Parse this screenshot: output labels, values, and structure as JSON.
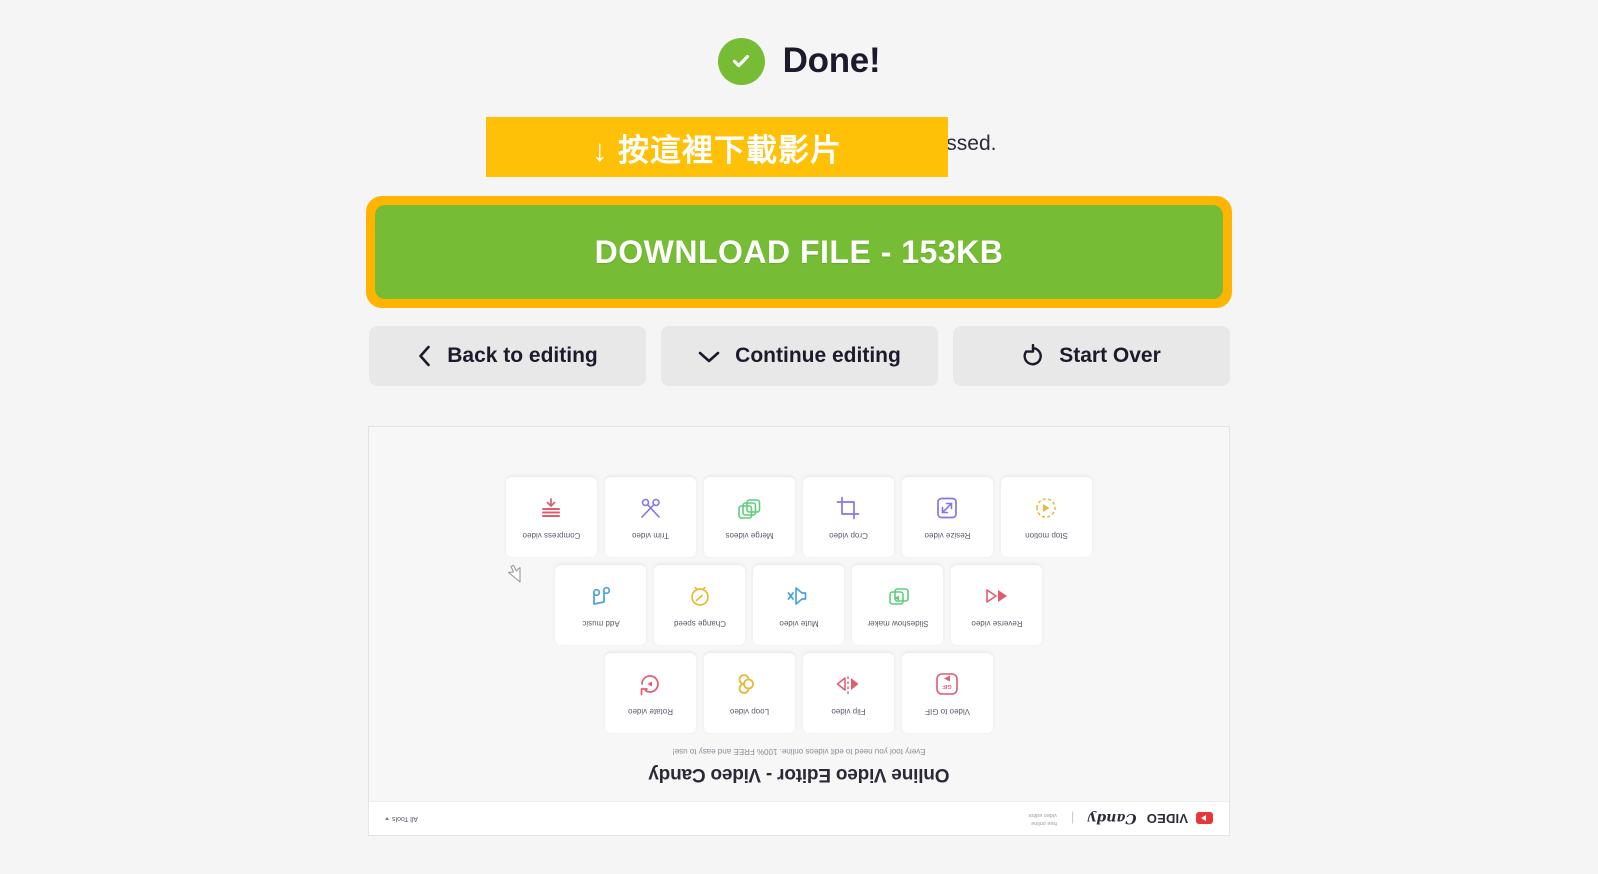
{
  "status": {
    "done_label": "Done!",
    "check_icon": "check-circle-icon",
    "message": "Your file has been successfully processed.",
    "overlay_banner": "↓ 按這裡下載影片",
    "overlay_color": "#ffc107"
  },
  "download": {
    "label": "DOWNLOAD FILE - 153KB",
    "file_size": "153KB",
    "button_color": "#76bc34",
    "highlight_border_color": "#ffb400"
  },
  "actions": [
    {
      "label": "Back to editing",
      "icon": "chevron-left-icon",
      "name": "back-to-editing"
    },
    {
      "label": "Continue editing",
      "icon": "chevron-down-icon",
      "name": "continue-editing"
    },
    {
      "label": "Start Over",
      "icon": "restart-rotate-icon",
      "name": "start-over"
    }
  ],
  "preview": {
    "rotated": "180",
    "header": {
      "logo_primary": "VIDEO",
      "logo_secondary": "Candy",
      "logo_icon": "video-play-logo-icon",
      "tagline_line1": "free online",
      "tagline_line2": "video editor",
      "all_tools": "All Tools"
    },
    "hero": {
      "title": "Online Video Editor - Video Candy",
      "subtitle": "Every tool you need to edit videos online. 100% FREE and easy to use!"
    },
    "tool_rows": [
      [
        {
          "label": "Video to GIF",
          "icon": "video-to-gif-icon",
          "color": "#e05c6e"
        },
        {
          "label": "Flip video",
          "icon": "flip-video-icon",
          "color": "#e05c6e"
        },
        {
          "label": "Loop video",
          "icon": "loop-video-icon",
          "color": "#e8b93a"
        },
        {
          "label": "Rotate video",
          "icon": "rotate-video-icon",
          "color": "#e05c6e"
        }
      ],
      [
        {
          "label": "Reverse video",
          "icon": "reverse-video-icon",
          "color": "#e05c6e"
        },
        {
          "label": "Slideshow maker",
          "icon": "slideshow-maker-icon",
          "color": "#5ece7b"
        },
        {
          "label": "Mute video",
          "icon": "mute-video-icon",
          "color": "#49a3e0"
        },
        {
          "label": "Change speed",
          "icon": "change-speed-icon",
          "color": "#e8b93a"
        },
        {
          "label": "Add music",
          "icon": "add-music-icon",
          "color": "#49a3e0"
        }
      ],
      [
        {
          "label": "Stop motion",
          "icon": "stop-motion-icon",
          "color": "#e8b93a"
        },
        {
          "label": "Resize video",
          "icon": "resize-video-icon",
          "color": "#8477e8"
        },
        {
          "label": "Crop video",
          "icon": "crop-video-icon",
          "color": "#8477e8"
        },
        {
          "label": "Merge videos",
          "icon": "merge-videos-icon",
          "color": "#5ece7b"
        },
        {
          "label": "Trim video",
          "icon": "trim-video-icon",
          "color": "#8477e8"
        },
        {
          "label": "Compress video",
          "icon": "compress-video-icon",
          "color": "#e05c6e"
        }
      ]
    ],
    "cursor_icon": "mouse-cursor-icon"
  }
}
